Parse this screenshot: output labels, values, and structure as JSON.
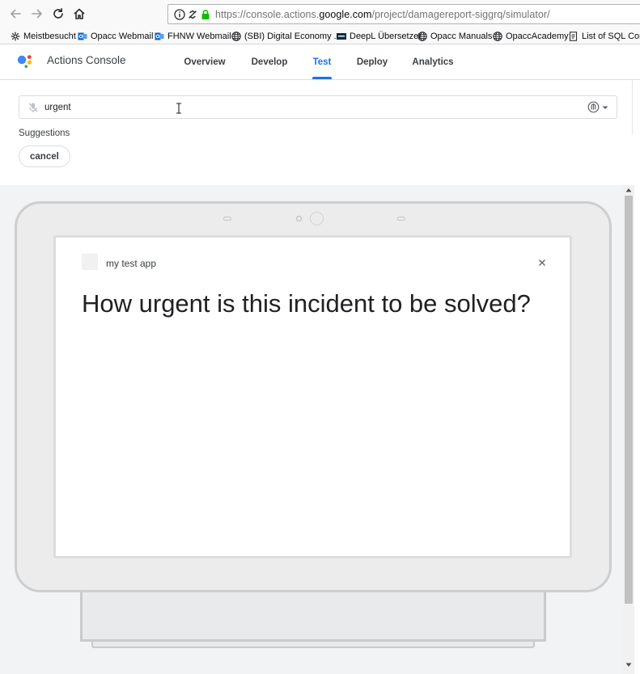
{
  "browser": {
    "url_prefix": "https://console.actions.",
    "url_host": "google.com",
    "url_path": "/project/damagereport-siggrq/simulator/",
    "bookmarks": [
      {
        "label": "Meistbesucht",
        "icon": "gear-icon"
      },
      {
        "label": "Opacc Webmail",
        "icon": "outlook-icon"
      },
      {
        "label": "FHNW Webmail",
        "icon": "outlook-icon"
      },
      {
        "label": "(SBI) Digital Economy ...",
        "icon": "globe-icon"
      },
      {
        "label": "DeepL Übersetzer",
        "icon": "deepl-icon"
      },
      {
        "label": "Opacc Manuals",
        "icon": "globe-icon"
      },
      {
        "label": "OpaccAcademy",
        "icon": "globe-icon"
      },
      {
        "label": "List of SQL Com",
        "icon": "page-icon"
      }
    ]
  },
  "header": {
    "title": "Actions Console",
    "tabs": [
      {
        "label": "Overview",
        "active": false
      },
      {
        "label": "Develop",
        "active": false
      },
      {
        "label": "Test",
        "active": true
      },
      {
        "label": "Deploy",
        "active": false
      },
      {
        "label": "Analytics",
        "active": false
      }
    ]
  },
  "input": {
    "value": "urgent",
    "suggestions_label": "Suggestions",
    "suggestions": [
      "cancel"
    ]
  },
  "simulator": {
    "app_name": "my test app",
    "prompt": "How urgent is this incident to be solved?"
  },
  "colors": {
    "accent": "#1a73e8",
    "ssl_lock": "#12bc00",
    "sim_background": "#f1f3f4"
  }
}
